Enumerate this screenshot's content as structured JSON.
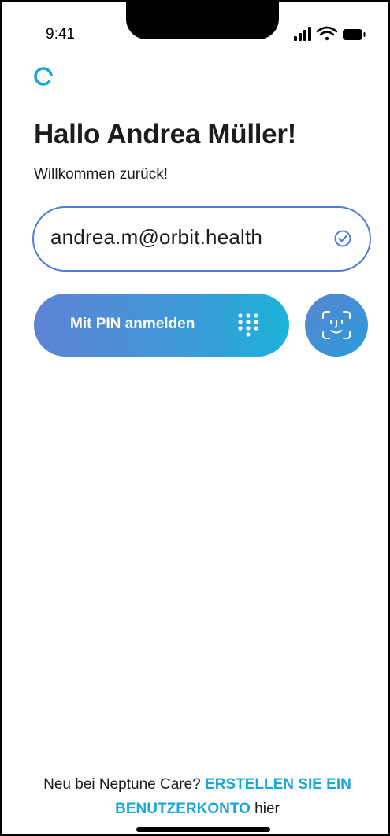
{
  "status_bar": {
    "time": "9:41",
    "icons": [
      "signal-icon",
      "wifi-icon",
      "battery-icon"
    ]
  },
  "brand": {
    "logo_icon": "spinner-ring-icon",
    "accent_color": "#1aa7d8",
    "gradient_start": "#5f82d6",
    "gradient_end": "#1bb3d9"
  },
  "header": {
    "greeting": "Hallo Andrea Müller!",
    "subtitle": "Willkommen zurück!"
  },
  "login": {
    "email_value": "andrea.m@orbit.health",
    "email_verified_icon": "check-circle-icon",
    "pin_button_label": "Mit PIN anmelden",
    "pin_button_icon": "keypad-icon",
    "face_id_icon": "face-id-icon"
  },
  "footer": {
    "prefix": "Neu bei Neptune Care? ",
    "link_text": "ERSTELLEN SIE EIN BENUTZERKONTO",
    "suffix": " hier"
  }
}
